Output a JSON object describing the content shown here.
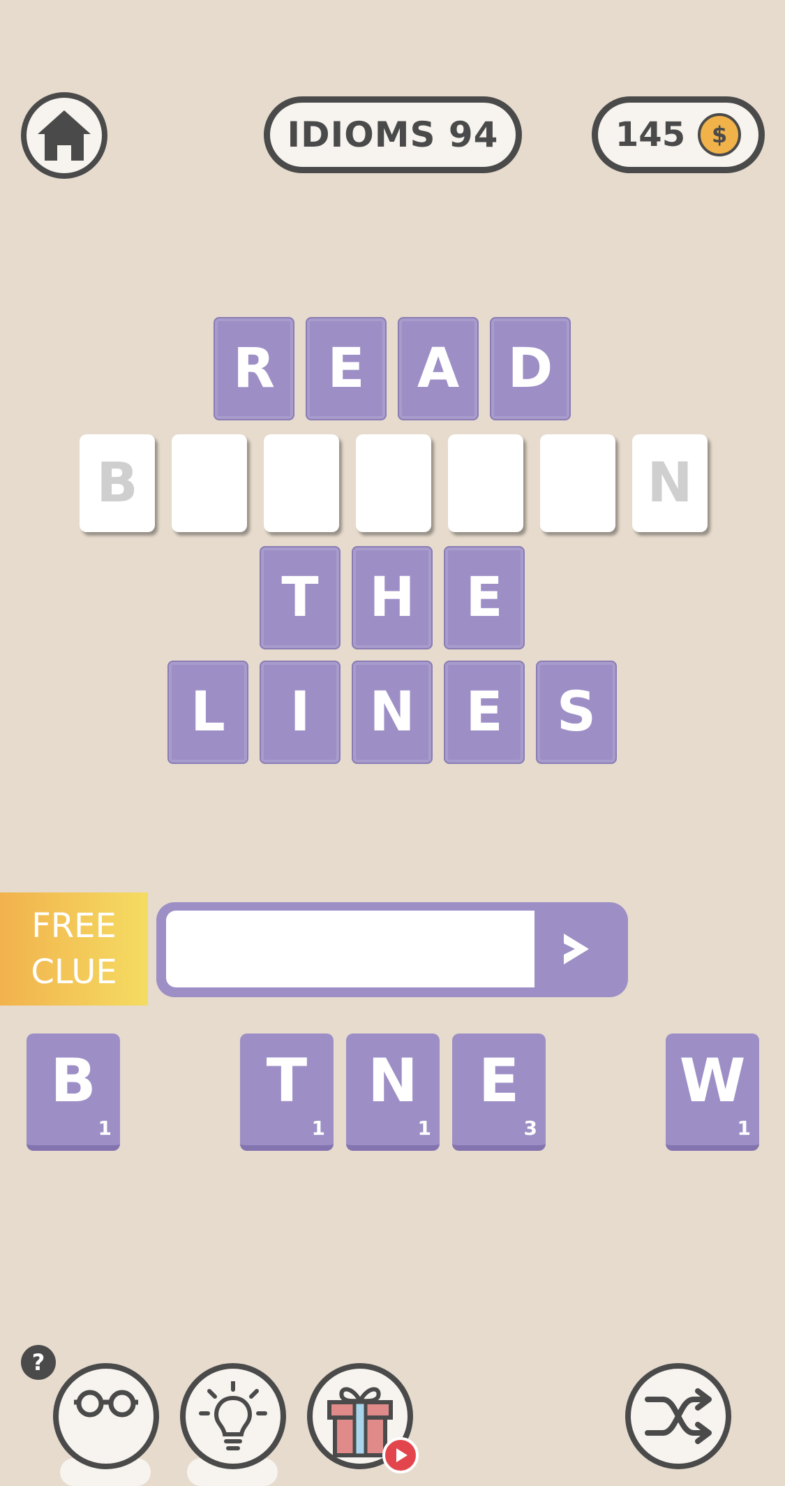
{
  "header": {
    "level_title": "IDIOMS 94",
    "coins": "145",
    "coin_symbol": "$"
  },
  "puzzle": {
    "rows": [
      {
        "state": "solved",
        "letters": [
          "R",
          "E",
          "A",
          "D"
        ]
      },
      {
        "state": "blank",
        "letters": [
          "B",
          "",
          "",
          "",
          "",
          "",
          "N"
        ]
      },
      {
        "state": "solved",
        "letters": [
          "T",
          "H",
          "E"
        ]
      },
      {
        "state": "solved",
        "letters": [
          "L",
          "I",
          "N",
          "E",
          "S"
        ]
      }
    ]
  },
  "clue": {
    "free_line1": "FREE",
    "free_line2": "CLUE",
    "input_value": "",
    "submit_symbol": "›"
  },
  "bank": [
    {
      "letter": "B",
      "count": "1"
    },
    {
      "letter": "T",
      "count": "1"
    },
    {
      "letter": "N",
      "count": "1"
    },
    {
      "letter": "E",
      "count": "3"
    },
    {
      "letter": "W",
      "count": "1"
    }
  ],
  "tools": {
    "help_label": "?",
    "icons": [
      "glasses-icon",
      "lightbulb-icon",
      "gift-icon",
      "shuffle-icon"
    ]
  },
  "colors": {
    "background": "#e6dbcd",
    "tile_purple": "#9d8fc6",
    "outline": "#4a4a4a",
    "free_clue_start": "#f2b24d",
    "free_clue_end": "#f4dc62"
  }
}
